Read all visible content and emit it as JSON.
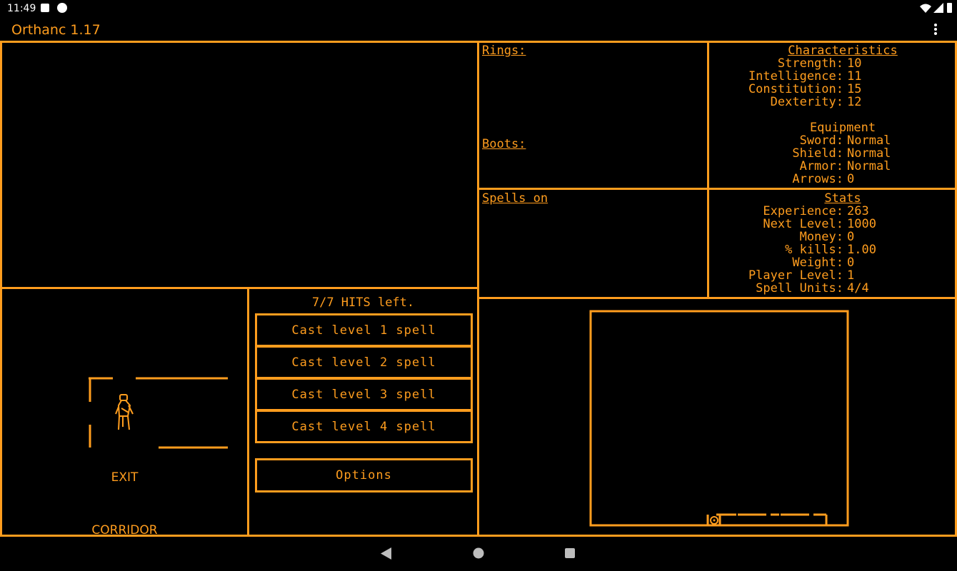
{
  "status_bar": {
    "time": "11:49"
  },
  "app": {
    "title": "Orthanc 1.17"
  },
  "colors": {
    "accent": "#ff9d1e",
    "background": "#000000"
  },
  "inventory": {
    "rings_label": "Rings:",
    "boots_label": "Boots:",
    "spells_label": "Spells on"
  },
  "characteristics": {
    "title": "Characteristics",
    "items": [
      {
        "k": "Strength:",
        "v": "10"
      },
      {
        "k": "Intelligence:",
        "v": "11"
      },
      {
        "k": "Constitution:",
        "v": "15"
      },
      {
        "k": "Dexterity:",
        "v": "12"
      }
    ]
  },
  "equipment": {
    "title": "Equipment",
    "items": [
      {
        "k": "Sword:",
        "v": "Normal"
      },
      {
        "k": "Shield:",
        "v": "Normal"
      },
      {
        "k": "Armor:",
        "v": "Normal"
      },
      {
        "k": "Arrows:",
        "v": "0"
      }
    ]
  },
  "stats": {
    "title": "Stats",
    "items": [
      {
        "k": "Experience:",
        "v": "263"
      },
      {
        "k": "Next Level:",
        "v": "1000"
      },
      {
        "k": "Money:",
        "v": "0"
      },
      {
        "k": "% kills:",
        "v": "1.00"
      },
      {
        "k": "Weight:",
        "v": "0"
      },
      {
        "k": "Player Level:",
        "v": "1"
      },
      {
        "k": "Spell Units:",
        "v": "4/4"
      }
    ]
  },
  "hits": "7/7 HITS left.",
  "spells": [
    "Cast level 1 spell",
    "Cast level 2 spell",
    "Cast level 3 spell",
    "Cast level 4 spell"
  ],
  "options_label": "Options",
  "room": {
    "exit_label": "EXIT",
    "location_label": "CORRIDOR"
  },
  "icons": {
    "menu": "overflow-menu-icon",
    "back": "nav-back-icon",
    "home": "nav-home-icon",
    "recents": "nav-recents-icon"
  }
}
